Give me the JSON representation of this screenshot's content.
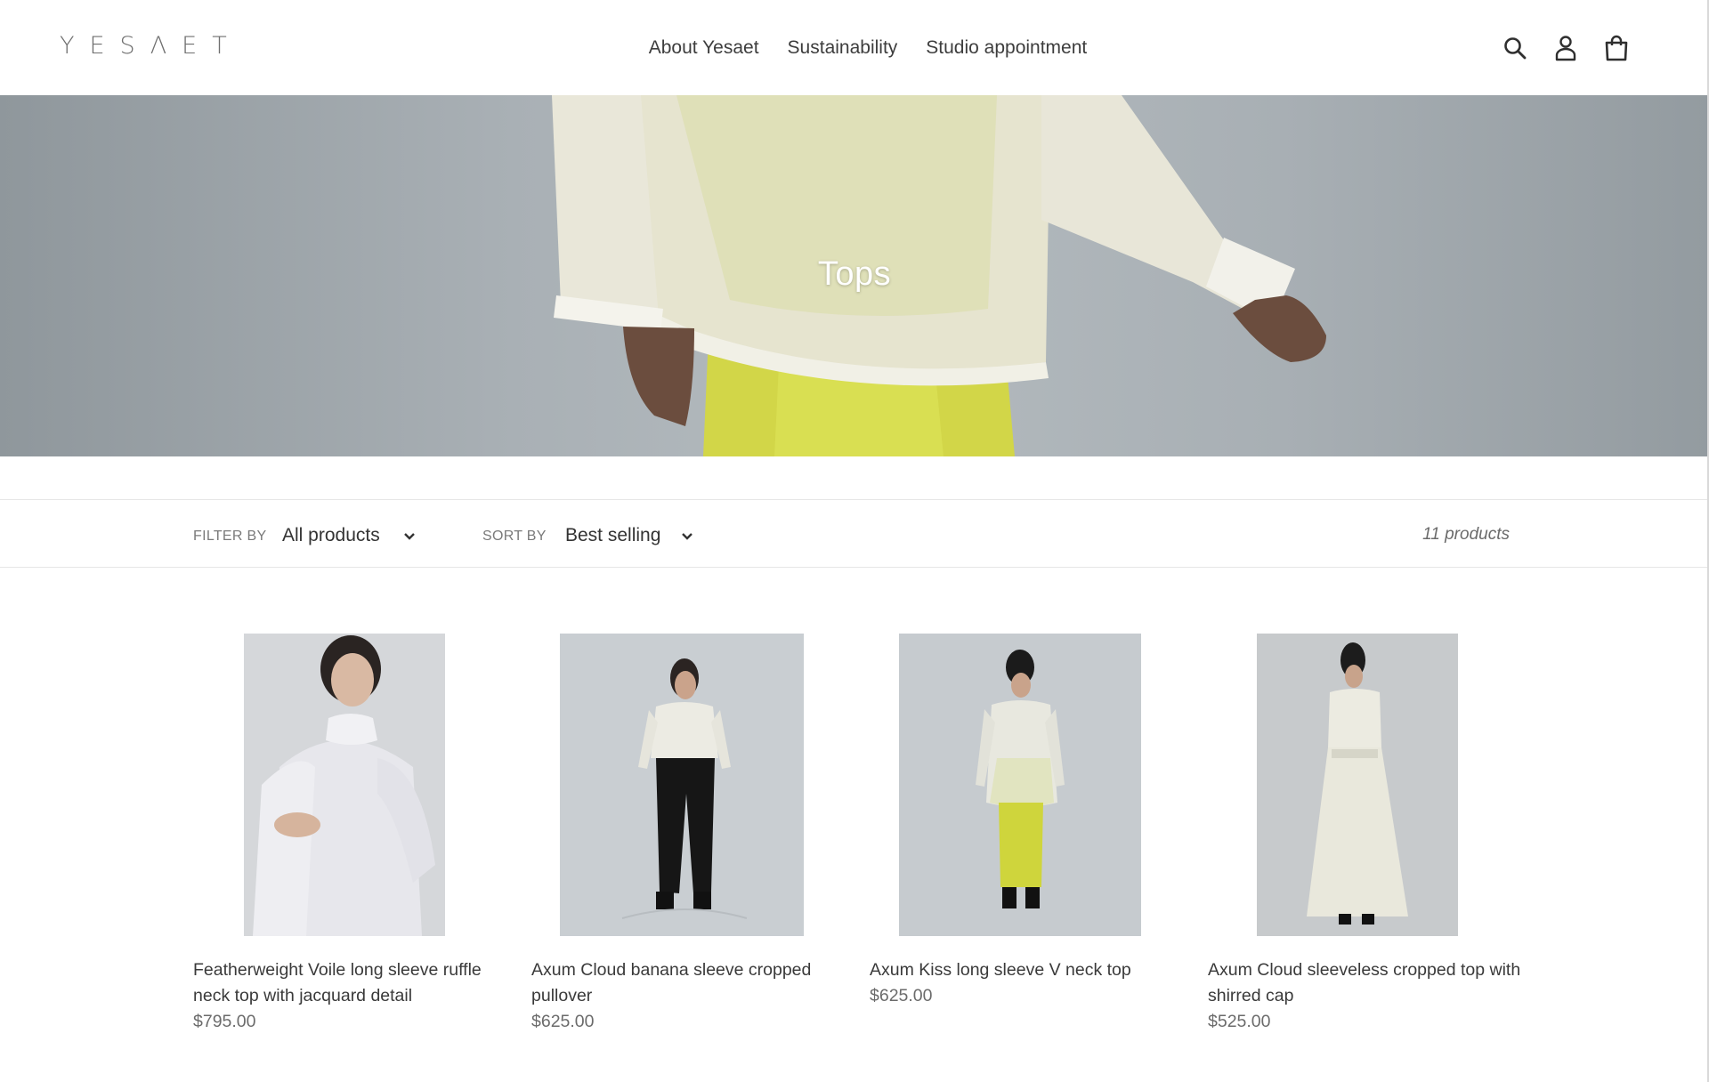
{
  "header": {
    "logo": "YESΛET",
    "nav": [
      "About Yesaet",
      "Sustainability",
      "Studio appointment"
    ],
    "icons": [
      "search-icon",
      "account-icon",
      "cart-icon"
    ]
  },
  "hero": {
    "title": "Tops"
  },
  "filters": {
    "filter_label": "FILTER BY",
    "filter_value": "All products",
    "sort_label": "SORT BY",
    "sort_value": "Best selling",
    "count": "11 products"
  },
  "products": [
    {
      "title": "Featherweight Voile long sleeve ruffle neck top with jacquard detail",
      "price": "$795.00"
    },
    {
      "title": "Axum Cloud banana sleeve cropped pullover",
      "price": "$625.00"
    },
    {
      "title": "Axum Kiss long sleeve V neck top",
      "price": "$625.00"
    },
    {
      "title": "Axum Cloud sleeveless cropped top with shirred cap",
      "price": "$525.00"
    }
  ],
  "colors": {
    "text": "#3a3a3a",
    "muted": "#6b6b6b",
    "accent_yellow": "#d6dc4a",
    "hero_grey": "#a9b0b5",
    "product_bg": "#c9cdd0"
  }
}
